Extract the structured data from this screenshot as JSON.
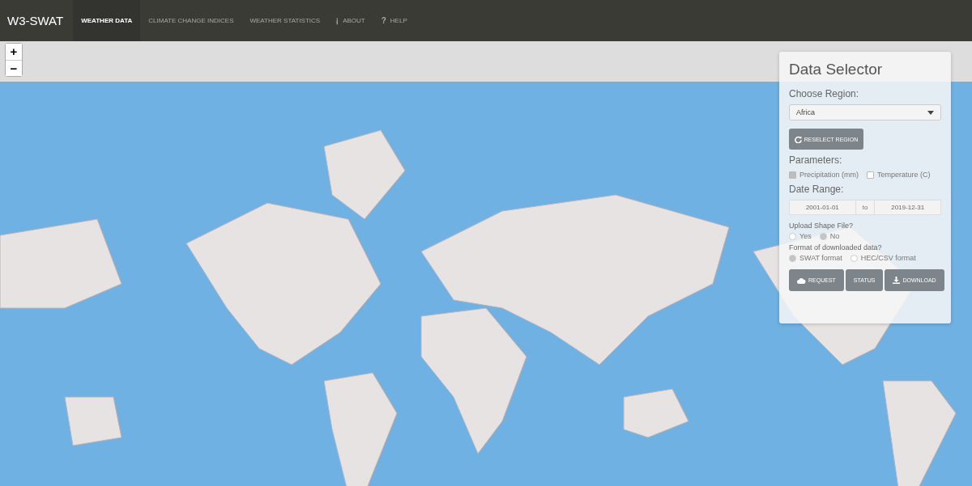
{
  "navbar": {
    "brand": "W3-SWAT",
    "tabs": [
      {
        "label": "WEATHER DATA",
        "selected": true
      },
      {
        "label": "CLIMATE CHANGE INDICES",
        "selected": false
      },
      {
        "label": "WEATHER STATISTICS",
        "selected": false
      },
      {
        "label": "ABOUT",
        "selected": false,
        "icon": "ℹ"
      },
      {
        "label": "HELP",
        "selected": false,
        "icon": "?"
      }
    ]
  },
  "zoom_buttons": [
    "+",
    "−"
  ],
  "data_selector": {
    "title": "Data Selector",
    "region_label": "Choose Region:",
    "region_value": "Africa",
    "reselect_button": "RESELECT REGION",
    "parameters_label": "Parameters:",
    "parameters": [
      {
        "label": "Precipitation (mm)",
        "checked": true
      },
      {
        "label": "Temperature (C)",
        "checked": false
      }
    ],
    "date_range_label": "Date Range:",
    "date_start": "2001-01-01",
    "date_separator": "to",
    "date_end": "2019-12-31",
    "upload_label": "Upload Shape File?",
    "upload_options": [
      {
        "label": "Yes",
        "selected": false
      },
      {
        "label": "No",
        "selected": true
      }
    ],
    "format_label": "Format of downloaded data?",
    "format_options": [
      {
        "label": "SWAT format",
        "selected": true
      },
      {
        "label": "HEC/CSV format",
        "selected": false
      }
    ],
    "buttons": [
      {
        "label": "REQUEST",
        "kind": "cloud"
      },
      {
        "label": "STATUS",
        "kind": "plain"
      },
      {
        "label": "DOWNLOAD",
        "kind": "download"
      }
    ]
  }
}
